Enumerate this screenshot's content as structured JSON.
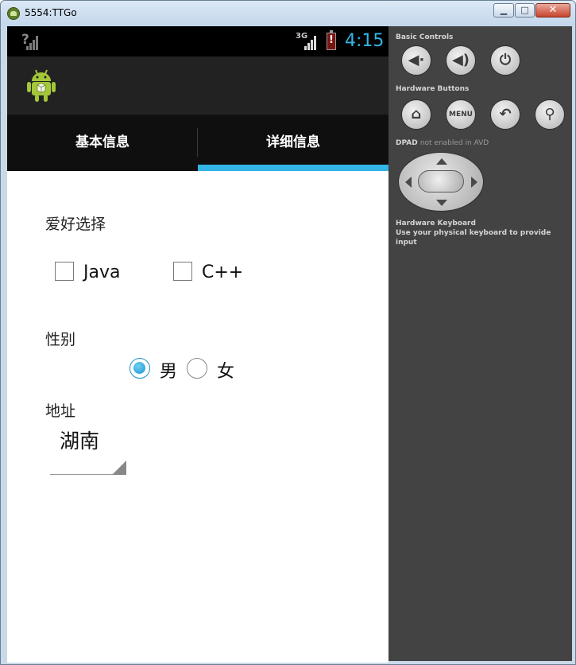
{
  "window": {
    "title": "5554:TTGo"
  },
  "status_bar": {
    "signal_unknown": "?",
    "network": "3G",
    "battery_alert": "!",
    "time": "4:15"
  },
  "tabs": [
    {
      "label": "基本信息",
      "selected": false
    },
    {
      "label": "详细信息",
      "selected": true
    }
  ],
  "form": {
    "hobbies": {
      "label": "爱好选择",
      "options": [
        {
          "label": "Java",
          "checked": false
        },
        {
          "label": "C++",
          "checked": false
        }
      ]
    },
    "gender": {
      "label": "性别",
      "options": [
        {
          "label": "男",
          "selected": true
        },
        {
          "label": "女",
          "selected": false
        }
      ]
    },
    "address": {
      "label": "地址",
      "selected_value": "湖南"
    }
  },
  "emulator_panel": {
    "basic_controls_title": "Basic Controls",
    "hardware_buttons_title": "Hardware Buttons",
    "menu_label": "MENU",
    "dpad_title": "DPAD",
    "dpad_note": "not enabled in AVD",
    "keyboard_title": "Hardware Keyboard",
    "keyboard_note": "Use your physical keyboard to provide input"
  },
  "colors": {
    "accent": "#33b5e5",
    "panel_bg": "#434343",
    "actionbar_bg": "#222222"
  }
}
